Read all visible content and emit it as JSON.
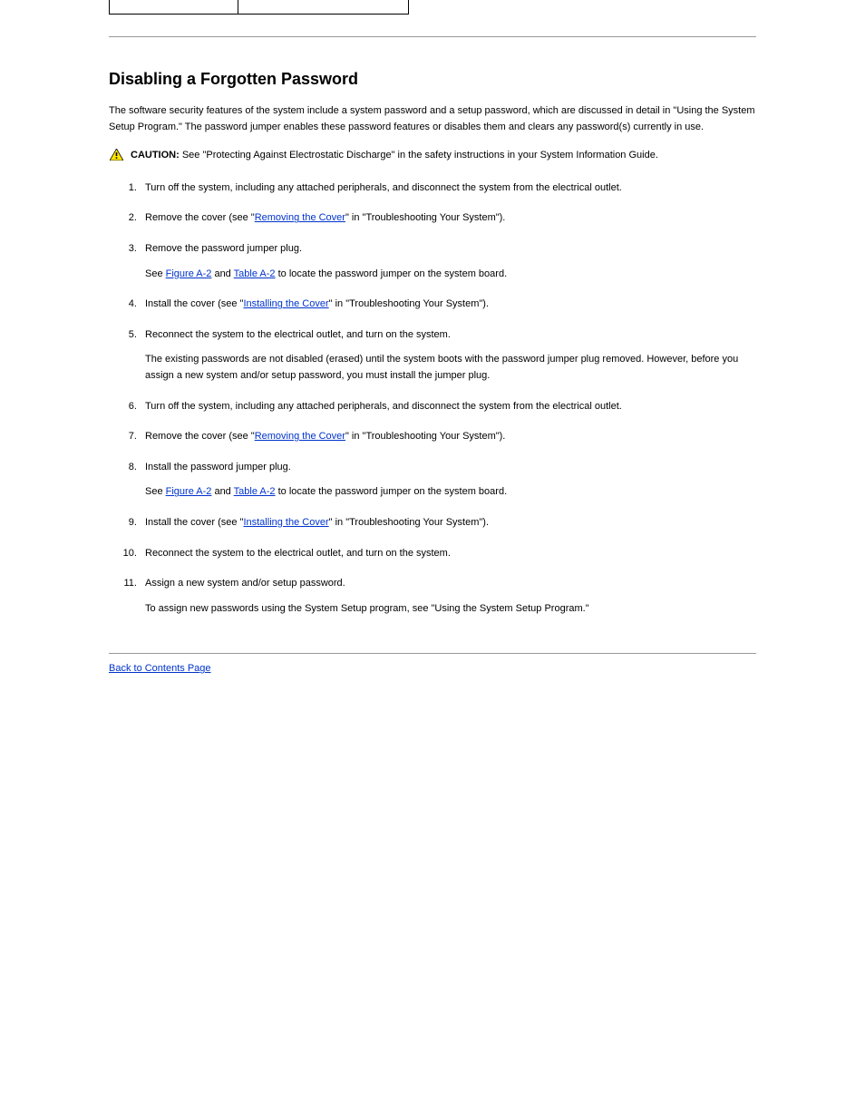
{
  "section": {
    "title": "Disabling a Forgotten Password",
    "intro_1": "The software security features of the system include a system password and a setup password, which are discussed in detail in \"Using the System Setup Program.\" The password jumper enables these password features or disables them and clears any password(s) currently in use.",
    "caution_label": "CAUTION:",
    "caution_text": " See \"Protecting Against Electrostatic Discharge\" in the safety instructions in your System Information Guide.",
    "steps": [
      {
        "text": "Turn off the system, including any attached peripherals, and disconnect the system from the electrical outlet."
      },
      {
        "text_prefix": "Remove the cover (see \"",
        "link1": "Removing the Cover",
        "text_suffix": "\" in \"Troubleshooting Your System\")."
      },
      {
        "text_prefix": "Remove the password jumper plug.",
        "sub_prefix": "See ",
        "sub_link1": "Figure A-2",
        "sub_mid": " and ",
        "sub_link2": "Table A-2",
        "sub_suffix": " to locate the password jumper on the system board."
      },
      {
        "text_prefix": "Install the cover (see \"",
        "link1": "Installing the Cover",
        "text_suffix": "\" in \"Troubleshooting Your System\")."
      },
      {
        "text": "Reconnect the system to the electrical outlet, and turn on the system.",
        "sub": "The existing passwords are not disabled (erased) until the system boots with the password jumper plug removed. However, before you assign a new system and/or setup password, you must install the jumper plug."
      },
      {
        "text": "Turn off the system, including any attached peripherals, and disconnect the system from the electrical outlet."
      },
      {
        "text_prefix": "Remove the cover (see \"",
        "link1": "Removing the Cover",
        "text_suffix": "\" in \"Troubleshooting Your System\")."
      },
      {
        "text_prefix": "Install the password jumper plug.",
        "sub_prefix": "See ",
        "sub_link1": "Figure A-2",
        "sub_mid": " and ",
        "sub_link2": "Table A-2",
        "sub_suffix": " to locate the password jumper on the system board."
      },
      {
        "text_prefix": "Install the cover (see \"",
        "link1": "Installing the Cover",
        "text_suffix": "\" in \"Troubleshooting Your System\")."
      },
      {
        "text": "Reconnect the system to the electrical outlet, and turn on the system."
      },
      {
        "text": "Assign a new system and/or setup password.",
        "sub": "To assign new passwords using the System Setup program, see \"Using the System Setup Program.\""
      }
    ],
    "back_link": "Back to Contents Page"
  }
}
